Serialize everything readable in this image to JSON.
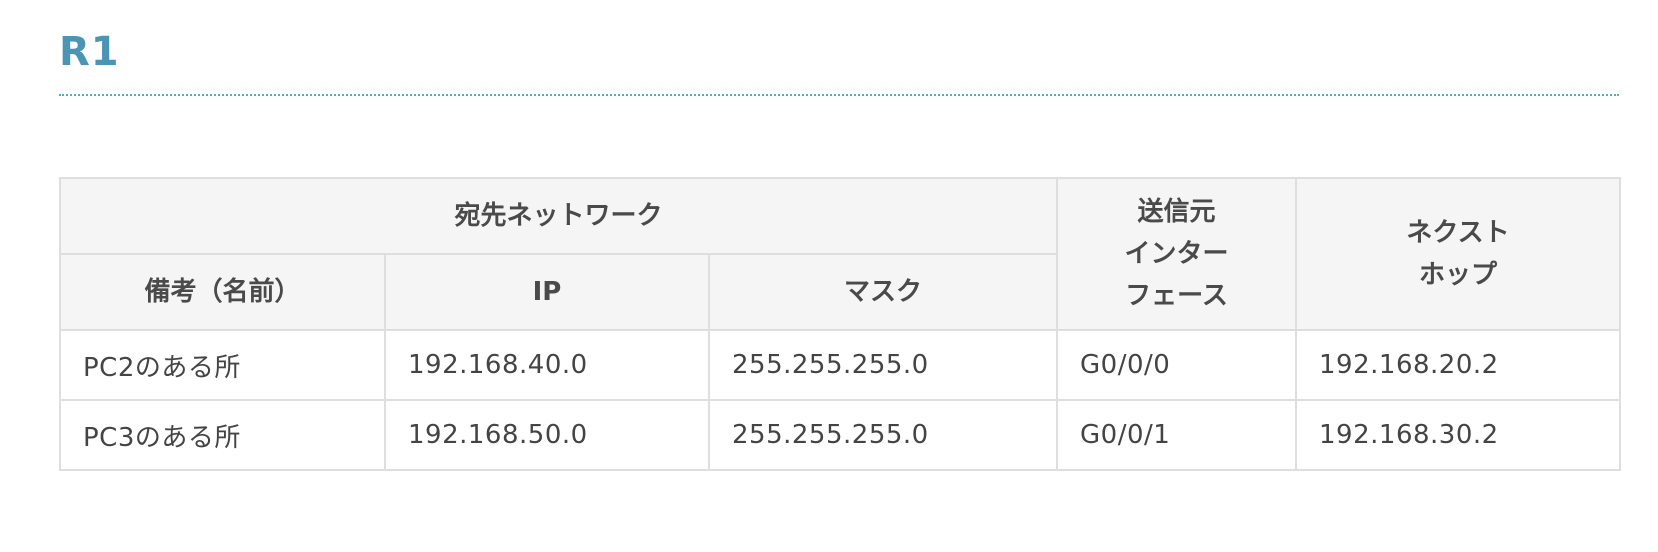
{
  "heading": "R1",
  "table": {
    "group_header": "宛先ネットワーク",
    "headers": {
      "note": "備考（名前）",
      "ip": "IP",
      "mask": "マスク",
      "interface_lines": [
        "送信元",
        "インター",
        "フェース"
      ],
      "nexthop_lines": [
        "ネクスト",
        "ホップ"
      ]
    },
    "rows": [
      {
        "note": "PC2のある所",
        "ip": "192.168.40.0",
        "mask": "255.255.255.0",
        "interface": "G0/0/0",
        "nexthop": "192.168.20.2"
      },
      {
        "note": "PC3のある所",
        "ip": "192.168.50.0",
        "mask": "255.255.255.0",
        "interface": "G0/0/1",
        "nexthop": "192.168.30.2"
      }
    ]
  }
}
